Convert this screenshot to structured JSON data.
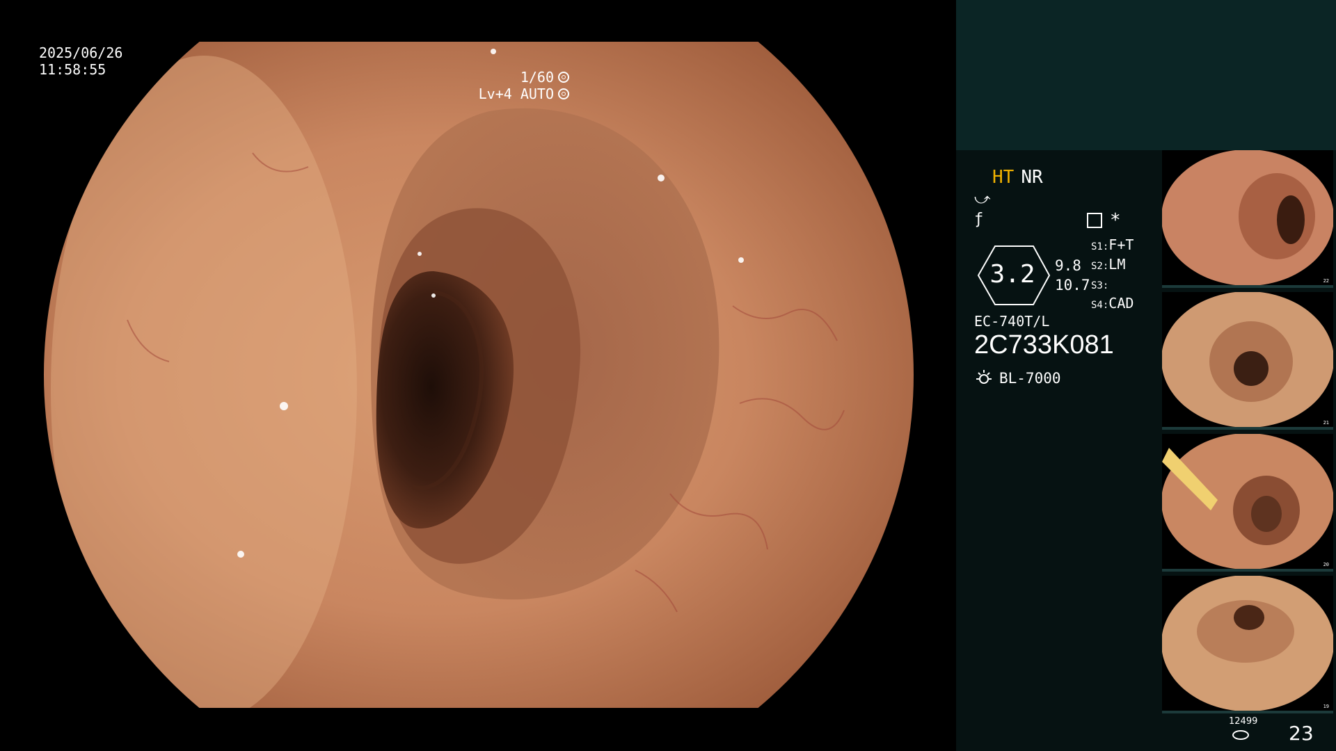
{
  "main": {
    "date": "2025/06/26",
    "time": "11:58:55",
    "shutter": "1/60",
    "level": "Lv+4 AUTO",
    "image_alt": "endoscopic colon lumen view"
  },
  "panel": {
    "mode_ht": "HT",
    "mode_nr": "NR",
    "ring_value": "3.2",
    "ring_side_top": "9.8",
    "ring_side_bottom": "10.7",
    "settings": [
      {
        "key": "S1:",
        "val": "F+T"
      },
      {
        "key": "S2:",
        "val": "LM"
      },
      {
        "key": "S3:",
        "val": ""
      },
      {
        "key": "S4:",
        "val": "CAD"
      }
    ],
    "model": "EC-740T/L",
    "serial": "2C733K081",
    "light_source": "BL-7000",
    "star": "*",
    "thumbnails": [
      {
        "num": "22"
      },
      {
        "num": "21"
      },
      {
        "num": "20"
      },
      {
        "num": "19"
      }
    ],
    "image_counter": "12499",
    "total_images": "23"
  },
  "colors": {
    "panel_bg": "#061212",
    "panel_top": "#0b2525",
    "ht_accent": "#f2b300"
  }
}
